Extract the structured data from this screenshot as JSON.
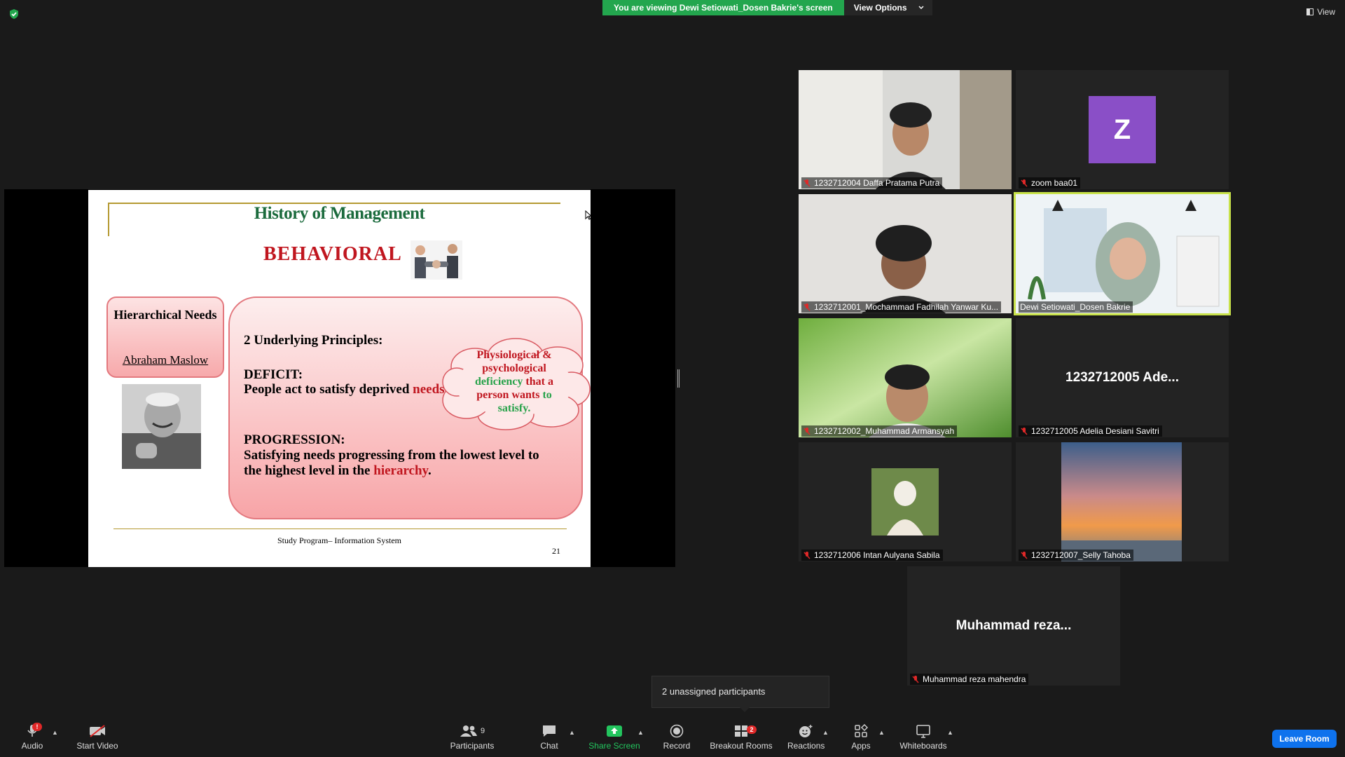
{
  "banner": {
    "viewing_text": "You are viewing Dewi Setiowati_Dosen Bakrie's screen",
    "view_options": "View Options"
  },
  "view_button": "View",
  "slide": {
    "title": "History of Management",
    "subtitle": "BEHAVIORAL",
    "left_box_title": "Hierarchical Needs",
    "left_box_name": "Abraham Maslow",
    "principles_heading": "2 Underlying Principles:",
    "deficit_heading": "DEFICIT:",
    "deficit_text_a": "People act to satisfy deprived ",
    "deficit_text_b": "needs",
    "deficit_text_c": ".",
    "progression_heading": "PROGRESSION:",
    "progression_text_1": "Satisfying needs progressing from the lowest level to",
    "progression_text_2a": "the highest level in the ",
    "progression_text_2b": "hierarchy",
    "progression_text_2c": ".",
    "cloud_1": "Physiological &",
    "cloud_2": "psychological",
    "cloud_3a": "deficiency",
    "cloud_3b": " that a",
    "cloud_4a": "person wants ",
    "cloud_4b": "to",
    "cloud_5": "satisfy.",
    "footer": "Study Program– Information System",
    "page": "21"
  },
  "participants": [
    {
      "name": "1232712004 Daffa Pratama Putra"
    },
    {
      "name": "zoom baa01",
      "initial": "Z"
    },
    {
      "name": "1232712001_Mochammad Fadhilah Yanwar Ku..."
    },
    {
      "name": "Dewi Setiowati_Dosen Bakrie"
    },
    {
      "name": "1232712002_Muhammad Armansyah"
    },
    {
      "name": "1232712005 Adelia Desiani Savitri",
      "display": "1232712005 Ade..."
    },
    {
      "name": "1232712006 Intan Aulyana Sabila"
    },
    {
      "name": "1232712007_Selly Tahoba"
    },
    {
      "name": "Muhammad reza mahendra",
      "display": "Muhammad reza..."
    }
  ],
  "unassigned": "2 unassigned participants",
  "toolbar": {
    "audio": "Audio",
    "audio_badge": "!",
    "video": "Start Video",
    "participants": "Participants",
    "participants_count": "9",
    "chat": "Chat",
    "share": "Share Screen",
    "record": "Record",
    "breakout": "Breakout Rooms",
    "breakout_badge": "2",
    "reactions": "Reactions",
    "apps": "Apps",
    "whiteboards": "Whiteboards",
    "leave": "Leave Room"
  },
  "colors": {
    "share_green": "#23a64e",
    "leave_blue": "#0e72ed",
    "active_speaker": "#c8e24a",
    "avatar_purple": "#8a4fc7"
  }
}
